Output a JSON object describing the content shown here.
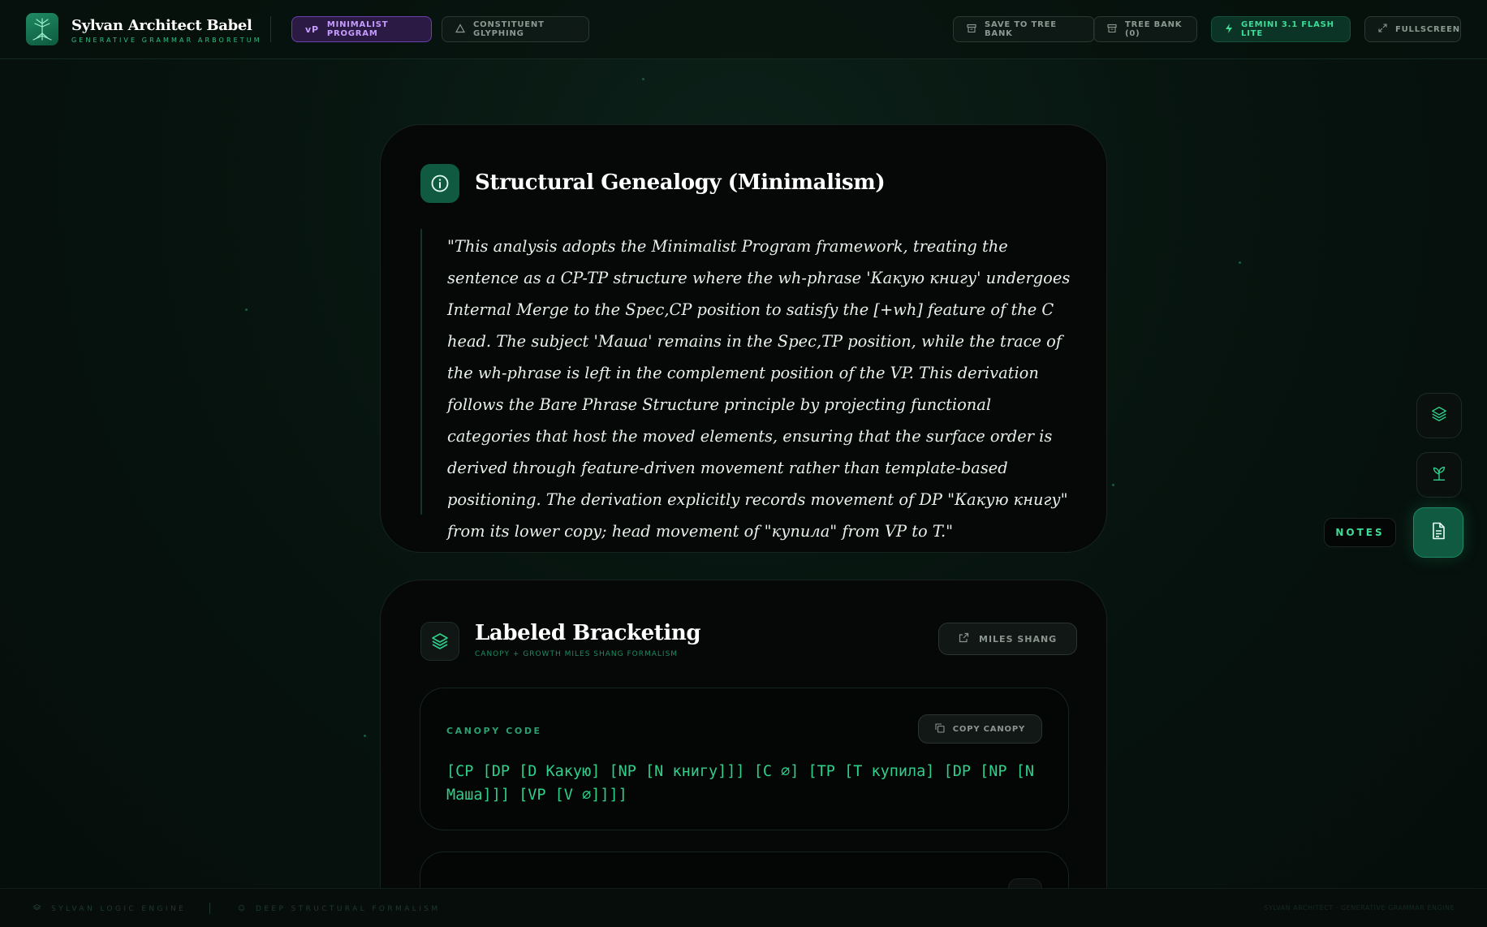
{
  "app": {
    "title": "Sylvan Architect Babel",
    "subtitle": "GENERATIVE GRAMMAR ARBORETUM"
  },
  "header": {
    "framework_badge": "vP",
    "framework_label": "MINIMALIST PROGRAM",
    "glyphing_label": "CONSTITUENT GLYPHING",
    "save_label": "SAVE TO TREE BANK",
    "treebank_label": "TREE BANK (0)",
    "model_label": "GEMINI 3.1 FLASH LITE",
    "fullscreen_label": "FULLSCREEN"
  },
  "genealogy": {
    "title": "Structural Genealogy (Minimalism)",
    "quote": "\"This analysis adopts the Minimalist Program framework, treating the sentence as a CP-TP structure where the wh-phrase 'Какую книгу' undergoes Internal Merge to the Spec,CP position to satisfy the [+wh] feature of the C head. The subject 'Маша' remains in the Spec,TP position, while the trace of the wh-phrase is left in the complement position of the VP. This derivation follows the Bare Phrase Structure principle by projecting functional categories that host the moved elements, ensuring that the surface order is derived through feature-driven movement rather than template-based positioning. The derivation explicitly records movement of DP \"Какую книгу\" from its lower copy; head movement of \"купила\" from VP to T.\""
  },
  "bracketing": {
    "title": "Labeled Bracketing",
    "subtitle": "CANOPY + GROWTH MILES SHANG FORMALISM",
    "miles_button": "MILES SHANG",
    "canopy_label": "CANOPY CODE",
    "copy_canopy": "COPY CANOPY",
    "canopy_code": "[CP [DP [D Какую] [NP [N книгу]]] [C ∅] [TP [T купила] [DP [NP [N Маша]]] [VP [V ∅]]]]"
  },
  "dock": {
    "notes_tip": "NOTES"
  },
  "footer": {
    "engine": "SYLVAN LOGIC ENGINE",
    "formalism": "DEEP STRUCTURAL FORMALISM",
    "right": "SYLVAN ARCHITECT · GENERATIVE GRAMMAR ENGINE"
  },
  "colors": {
    "accent": "#2fcf8c",
    "accent_dark": "#0f5a40",
    "purple": "#c79cff",
    "background": "#050d0a"
  }
}
